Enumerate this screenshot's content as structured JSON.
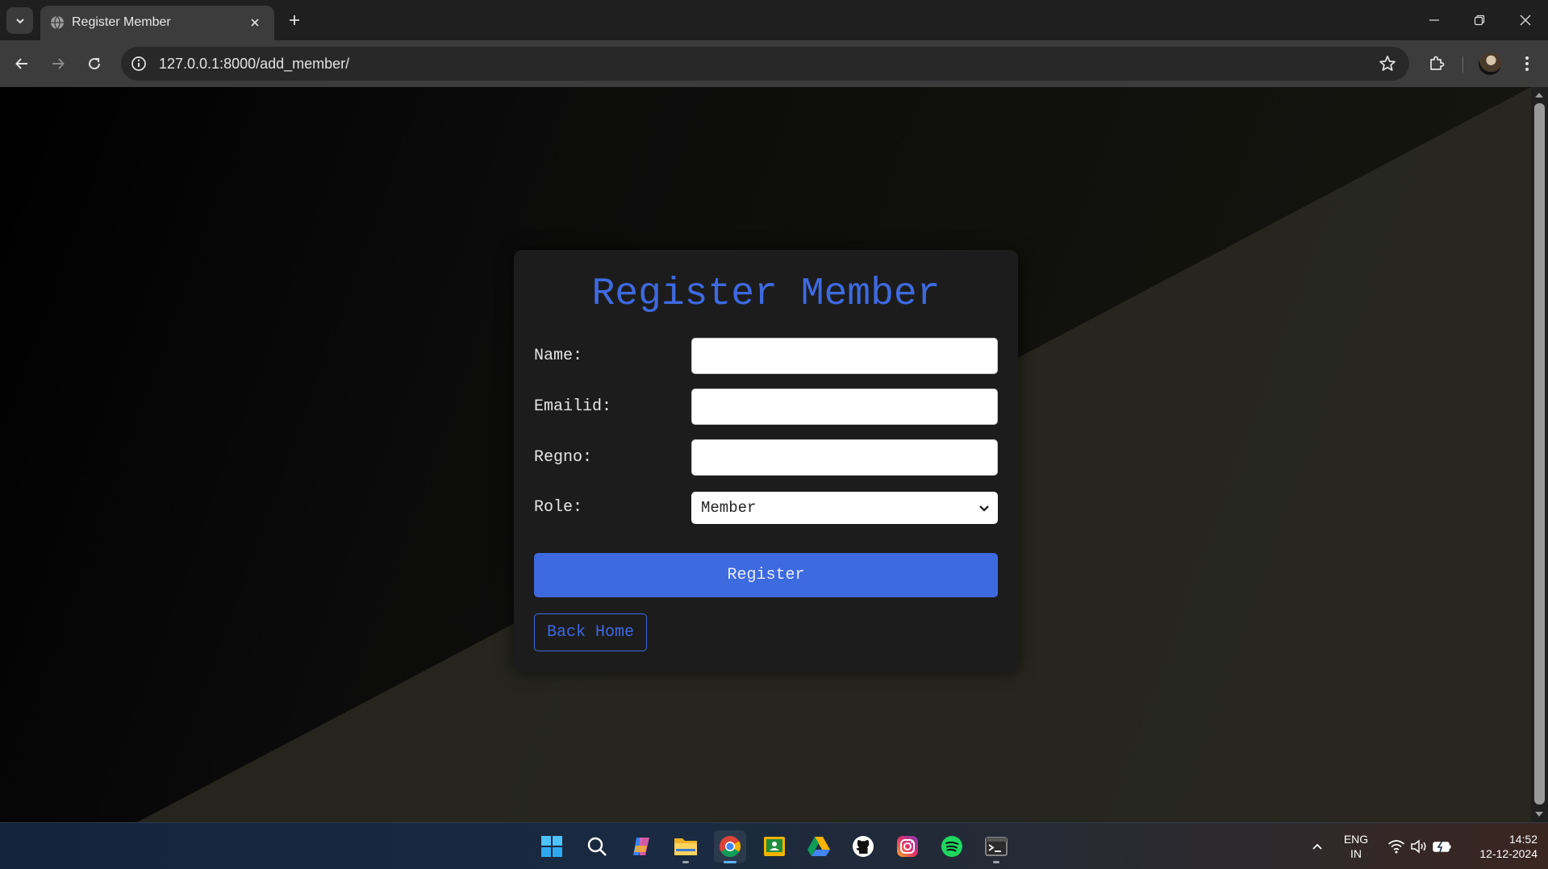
{
  "browser": {
    "tab_title": "Register Member",
    "url": "127.0.0.1:8000/add_member/"
  },
  "form": {
    "heading": "Register Member",
    "fields": [
      {
        "label": "Name:",
        "value": ""
      },
      {
        "label": "Emailid:",
        "value": ""
      },
      {
        "label": "Regno:",
        "value": ""
      }
    ],
    "role_label": "Role:",
    "role_selected": "Member",
    "register_label": "Register",
    "back_home_label": "Back Home"
  },
  "colors": {
    "accent": "#3e6ae0",
    "card_bg": "#1c1c1c"
  },
  "taskbar": {
    "apps": [
      "windows-start",
      "search",
      "copilot",
      "file-explorer",
      "chrome",
      "google-classroom",
      "google-drive",
      "github",
      "instagram",
      "spotify",
      "terminal"
    ],
    "language_line1": "ENG",
    "language_line2": "IN",
    "time": "14:52",
    "date": "12-12-2024"
  }
}
